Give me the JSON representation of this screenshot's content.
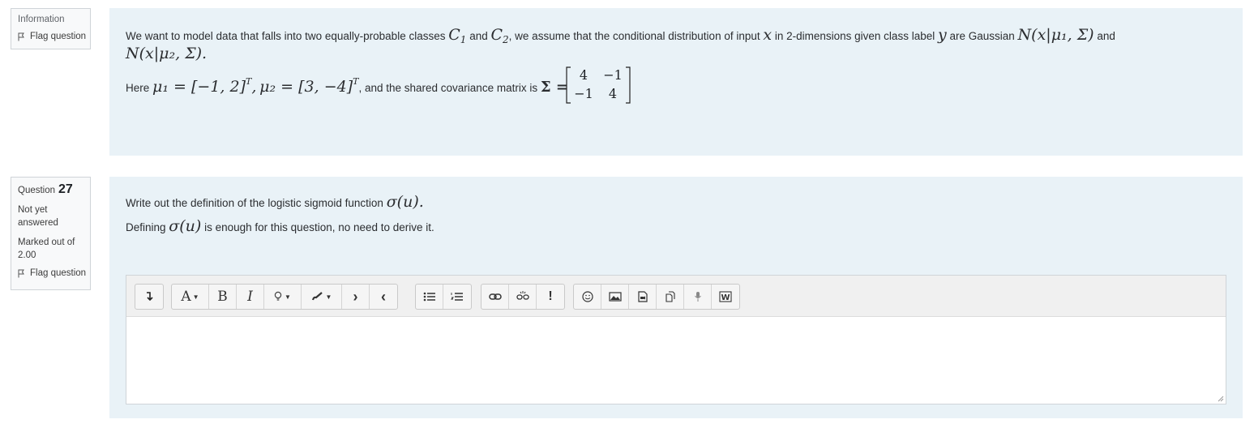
{
  "info_block": {
    "label": "Information",
    "flag": "Flag question",
    "text": {
      "line1_part1": "We want to model data that falls into two equally-probable classes",
      "c1": "C",
      "c1_sub": "1",
      "and1": "and",
      "c2": "C",
      "c2_sub": "2",
      "line1_part2": ", we assume that the conditional distribution of input",
      "x": "x",
      "line1_part3": "in 2-dimensions given class label",
      "y": "y",
      "line1_part4": "are Gaussian",
      "gauss1": "N(x|μ₁, Σ)",
      "and2": "and",
      "gauss2": "N(x|μ₂, Σ).",
      "here": "Here",
      "mu1_expr": "μ₁ = [−1, 2]",
      "mu2_expr": "μ₂ = [3, −4]",
      "sup_T": "T",
      "comma": ",",
      "shared": ", and the shared covariance matrix is",
      "sigma_eq": "Σ ="
    },
    "matrix": [
      "4",
      "−1",
      "−1",
      "4"
    ]
  },
  "question": {
    "label": "Question",
    "number": "27",
    "status": "Not yet answered",
    "marked": "Marked out of 2.00",
    "flag": "Flag question",
    "prompt1_a": "Write out the definition of the logistic sigmoid function",
    "sigma": "σ(u).",
    "prompt2_a": "Defining",
    "sigma2": "σ(u)",
    "prompt2_b": "is enough for this question, no need to derive it."
  },
  "toolbar": {
    "groups": [
      [
        "show-more-icon"
      ],
      [
        "font-size-icon",
        "bold-icon",
        "italic-icon",
        "style-icon",
        "highlight-icon",
        "indent-icon",
        "outdent-icon"
      ],
      [
        "unordered-list-icon",
        "ordered-list-icon"
      ],
      [
        "link-icon",
        "unlink-icon",
        "emoji-nbsp-icon"
      ],
      [
        "emoji-icon",
        "image-icon",
        "media-icon",
        "manage-files-icon",
        "record-audio-icon",
        "word-import-icon"
      ]
    ],
    "labels": {
      "font": "A",
      "bold": "B",
      "italic": "I",
      "exclaim": "!"
    }
  }
}
